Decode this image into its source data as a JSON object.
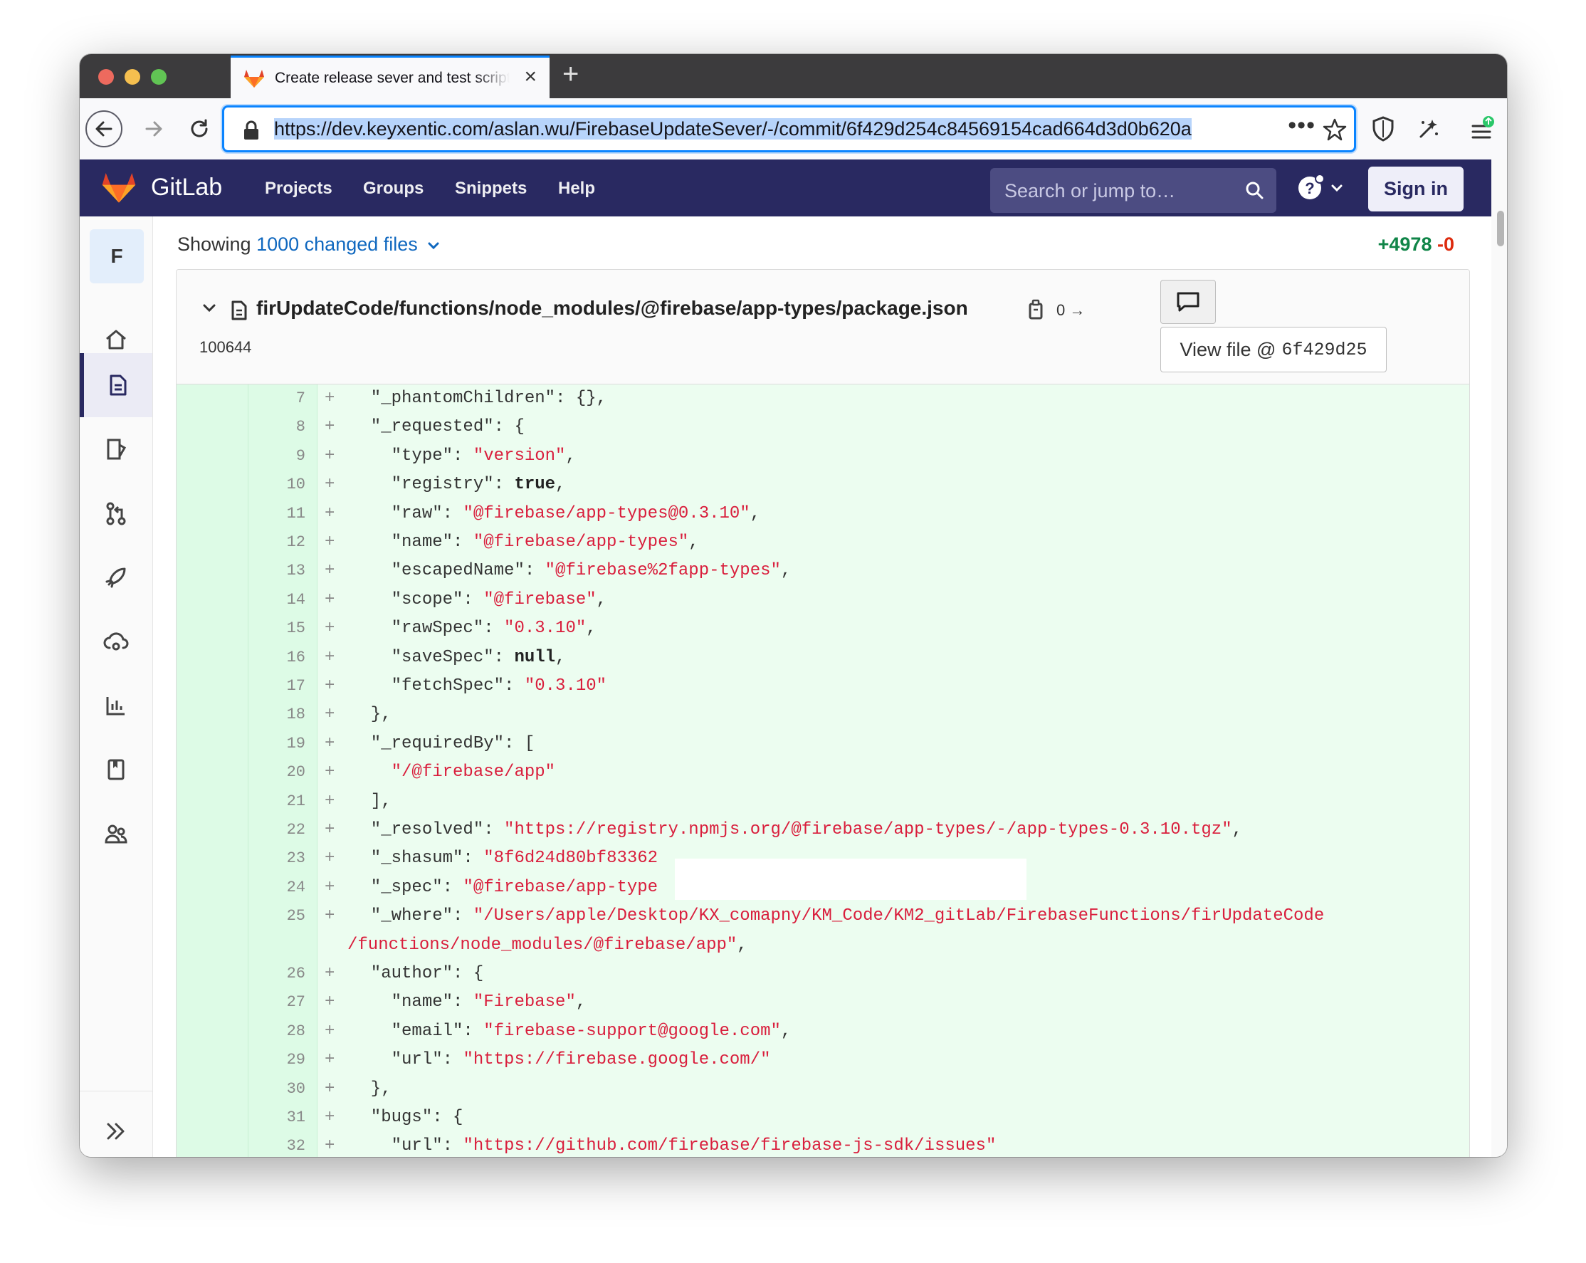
{
  "browser": {
    "tab_title": "Create release sever and test script",
    "url": "https://dev.keyxentic.com/aslan.wu/FirebaseUpdateSever/-/commit/6f429d254c84569154cad664d3d0b620a"
  },
  "gitlab": {
    "brand": "GitLab",
    "nav": [
      "Projects",
      "Groups",
      "Snippets",
      "Help"
    ],
    "search_placeholder": "Search or jump to…",
    "sign_in": "Sign in",
    "project_initial": "F"
  },
  "commit": {
    "showing_prefix": "Showing",
    "changed_files": "1000 changed files",
    "additions": "+4978",
    "deletions": "-0"
  },
  "file": {
    "path": "firUpdateCode/functions/node_modules/@firebase/app-types/package.json",
    "changes": "0 →",
    "mode": "100644",
    "view_file_label": "View file @",
    "view_file_sha": "6f429d25"
  },
  "diff_lines": [
    {
      "n": "7",
      "html": "  \"_phantomChildren\": {},"
    },
    {
      "n": "8",
      "html": "  \"_requested\": {"
    },
    {
      "n": "9",
      "html": "    \"type\": <span class=\"s\">\"version\"</span>,"
    },
    {
      "n": "10",
      "html": "    \"registry\": <span class=\"k\">true</span>,"
    },
    {
      "n": "11",
      "html": "    \"raw\": <span class=\"s\">\"@firebase/app-types@0.3.10\"</span>,"
    },
    {
      "n": "12",
      "html": "    \"name\": <span class=\"s\">\"@firebase/app-types\"</span>,"
    },
    {
      "n": "13",
      "html": "    \"escapedName\": <span class=\"s\">\"@firebase%2fapp-types\"</span>,"
    },
    {
      "n": "14",
      "html": "    \"scope\": <span class=\"s\">\"@firebase\"</span>,"
    },
    {
      "n": "15",
      "html": "    \"rawSpec\": <span class=\"s\">\"0.3.10\"</span>,"
    },
    {
      "n": "16",
      "html": "    \"saveSpec\": <span class=\"k\">null</span>,"
    },
    {
      "n": "17",
      "html": "    \"fetchSpec\": <span class=\"s\">\"0.3.10\"</span>"
    },
    {
      "n": "18",
      "html": "  },"
    },
    {
      "n": "19",
      "html": "  \"_requiredBy\": ["
    },
    {
      "n": "20",
      "html": "    <span class=\"s\">\"/@firebase/app\"</span>"
    },
    {
      "n": "21",
      "html": "  ],"
    },
    {
      "n": "22",
      "html": "  \"_resolved\": <span class=\"s\">\"https://registry.npmjs.org/@firebase/app-types/-/app-types-0.3.10.tgz\"</span>,"
    },
    {
      "n": "23",
      "html": "  \"_shasum\": <span class=\"s\">\"8f6d24d80bf83362</span>"
    },
    {
      "n": "24",
      "html": "  \"_spec\": <span class=\"s\">\"@firebase/app-type</span>"
    },
    {
      "n": "25",
      "html": "  \"_where\": <span class=\"s\">\"/Users/apple/Desktop/KX_comapny/KM_Code/KM2_gitLab/FirebaseFunctions/firUpdateCode</span>",
      "wrap": "<span class=\"s\">/functions/node_modules/@firebase/app\"</span>,"
    },
    {
      "n": "26",
      "html": "  \"author\": {"
    },
    {
      "n": "27",
      "html": "    \"name\": <span class=\"s\">\"Firebase\"</span>,"
    },
    {
      "n": "28",
      "html": "    \"email\": <span class=\"s\">\"firebase-support@google.com\"</span>,"
    },
    {
      "n": "29",
      "html": "    \"url\": <span class=\"s\">\"https://firebase.google.com/\"</span>"
    },
    {
      "n": "30",
      "html": "  },"
    },
    {
      "n": "31",
      "html": "  \"bugs\": {"
    },
    {
      "n": "32",
      "html": "    \"url\": <span class=\"s\">\"https://github.com/firebase/firebase-js-sdk/issues\"</span>"
    }
  ]
}
